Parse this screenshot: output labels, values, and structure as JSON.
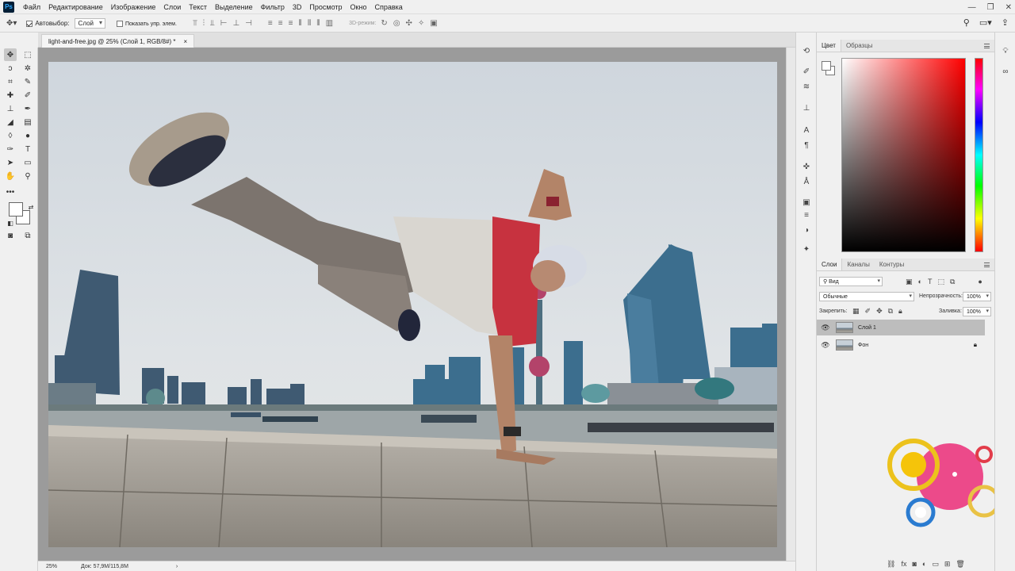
{
  "app": {
    "logo_text": "Ps"
  },
  "menu": [
    "Файл",
    "Редактирование",
    "Изображение",
    "Слои",
    "Текст",
    "Выделение",
    "Фильтр",
    "3D",
    "Просмотр",
    "Окно",
    "Справка"
  ],
  "window_controls": {
    "minimize": "—",
    "restore": "❐",
    "close": "✕"
  },
  "options_bar": {
    "auto_select_label": "Автовыбор:",
    "auto_select_value": "Слой",
    "show_controls_label": "Показать упр. элем.",
    "mode_3d_label": "3D-режим:"
  },
  "document": {
    "tab_title": "light-and-free.jpg @ 25% (Слой 1, RGB/8#) *",
    "close_glyph": "×"
  },
  "status": {
    "zoom": "25%",
    "doc_info": "Док: 57,9M/115,8M",
    "arrow": "›"
  },
  "color_panel": {
    "tabs": [
      "Цвет",
      "Образцы"
    ]
  },
  "layers_panel": {
    "tabs": [
      "Слои",
      "Каналы",
      "Контуры"
    ],
    "filter_kind": "Вид",
    "blend_mode": "Обычные",
    "opacity_label": "Непрозрачность:",
    "opacity_value": "100%",
    "lock_label": "Закрепить:",
    "fill_label": "Заливка:",
    "fill_value": "100%",
    "layers": [
      {
        "name": "Слой 1",
        "selected": true,
        "locked": false
      },
      {
        "name": "Фон",
        "selected": false,
        "locked": true
      }
    ],
    "footer_icons": [
      "link-icon",
      "fx-icon",
      "mask-icon",
      "adjustment-icon",
      "folder-icon",
      "new-layer-icon",
      "trash-icon"
    ],
    "fx_label": "fx"
  },
  "colors": {
    "accent_selected_layer": "#bdbdbd",
    "canvas_bg": "#9b9b9b",
    "panel_bg": "#f0f0f0"
  }
}
